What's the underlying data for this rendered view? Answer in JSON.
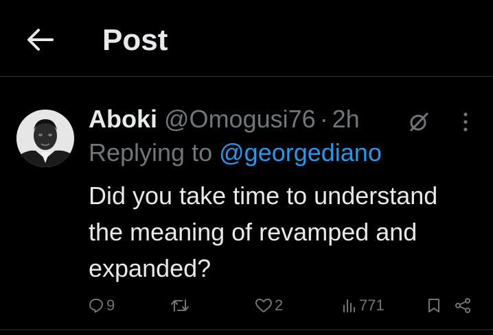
{
  "header": {
    "title": "Post"
  },
  "post": {
    "display_name": "Aboki",
    "handle": "@Omogusi76",
    "separator": "·",
    "time": "2h",
    "replying_prefix": "Replying to",
    "replying_to": "@georgediano",
    "text": "Did you take time to understand the meaning of revamped and expanded?",
    "actions": {
      "replies": "9",
      "reposts": "",
      "likes": "2",
      "views": "771"
    }
  },
  "icons": {
    "back": "arrow-left-icon",
    "grok": "grok-icon",
    "more": "more-vertical-icon",
    "reply": "reply-icon",
    "repost": "repost-icon",
    "like": "heart-icon",
    "views": "views-bar-icon",
    "bookmark": "bookmark-icon",
    "share": "share-icon"
  },
  "colors": {
    "background": "#000000",
    "text": "#e7e9ea",
    "muted": "#71767b",
    "link": "#1d9bf0",
    "divider": "#2f3336"
  }
}
